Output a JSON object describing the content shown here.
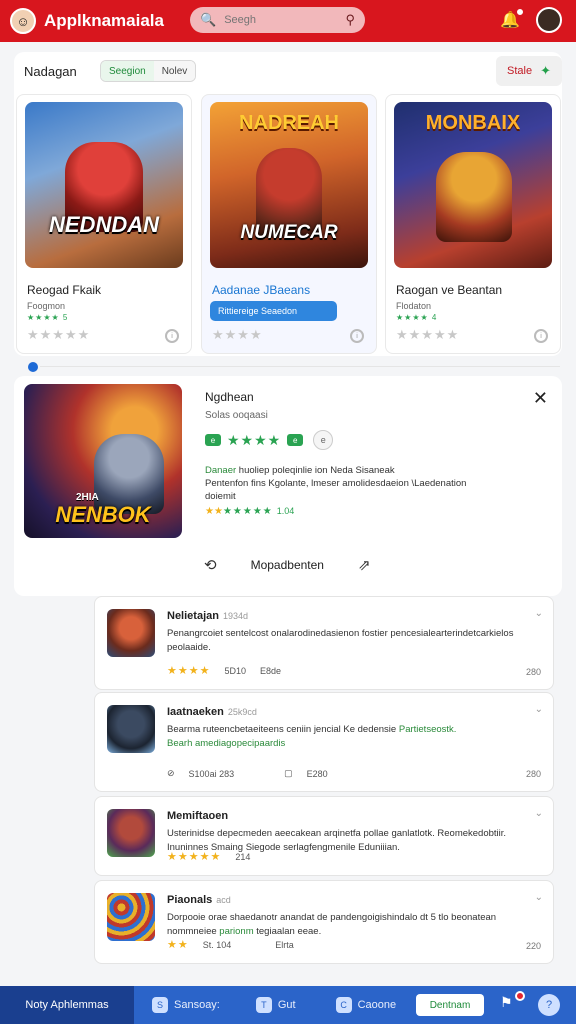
{
  "app": {
    "brand_name": "Applknamaiala",
    "search_placeholder": "Seegh"
  },
  "featured": {
    "title": "Nadagan",
    "chips": [
      "Seegion",
      "Nolev"
    ],
    "sale_label": "Stale",
    "cards": [
      {
        "thumb_title": "NEDNDAN",
        "name": "Reogad Fkaik",
        "sub": "Foogmon",
        "small_stars": "★★★★ 5"
      },
      {
        "thumb_title": "NUMECAR",
        "thumb_top_title": "NADREAH",
        "name": "Aadanae JBaeans",
        "button_label": "Rittiereige Seaedon"
      },
      {
        "thumb_top_title": "MONBAIX",
        "name": "Raogan ve Beantan",
        "sub": "Flodaton",
        "small_stars": "★★★★ 4"
      }
    ]
  },
  "detail": {
    "title": "Ngdhean",
    "subtitle": "Solas ooqaasi",
    "pill_label": "e",
    "ring_label": "e",
    "desc_line1_accent": "Danaer",
    "desc_line1": " huoliep poleqinlie ion Neda  Sisaneak",
    "desc_line2": "Pentenfon fins Kgolante, lmeser amolidesdaeion \\Laedenation",
    "desc_line3": "doiemit",
    "score_gold": "★★",
    "score_green": "★★★★★",
    "score_value": "1.04",
    "thumb_title": "NENBOK",
    "thumb_small": "2HIA",
    "action_label": "Mopadbenten"
  },
  "reviews": [
    {
      "name": "Nelietajan",
      "meta": "1934d",
      "text": "Penangrcoiet sentelcost onalarodinedasienon fostier pencesialearterindetcarkielos peolaaide.",
      "stars": "★★★★",
      "a": "5D10",
      "b": "E8de",
      "count": "280"
    },
    {
      "name": "Iaatnaeken",
      "meta": "25k9cd",
      "text": "Bearma ruteencbetaeiteens ceniin jencial Ke dedensie ",
      "text_accent": "Partietseostk.",
      "text2": "Bearh amediagopecipaardis",
      "a": "S100ai 283",
      "b": "E280",
      "count": "280"
    },
    {
      "name": "Memiftaoen",
      "meta": "",
      "text": "Usterinidse depecmeden aeecakean arqinetfa pollae ganlatlotk. Reomekedobtiir. Inuninnes Smaing Siegode serlagfengmenile Eduniiian.",
      "stars": "★★★★★",
      "a": "214",
      "count": ""
    },
    {
      "name": "Piaonals",
      "meta": "acd",
      "text": "Dorpooie orae shaedanotr anandat de pandengoigishindalo dt 5 tlo beonatean nommneiee",
      "text_accent": "parionm",
      "text2": " tegiaalan eeae.",
      "stars": "★★",
      "a": "St. 104",
      "b": "Elrta",
      "count": "220"
    }
  ],
  "bottom_nav": {
    "primary": "Noty Aphlemmas",
    "items": [
      {
        "label": "Sansoay:",
        "icon": "S"
      },
      {
        "label": "Gut",
        "icon": "T"
      },
      {
        "label": "Caoone",
        "icon": "C"
      }
    ],
    "cta": "Dentnam",
    "help_icon": "?"
  },
  "colors": {
    "brand_red": "#d8161e",
    "accent_green": "#2aa352",
    "nav_blue": "#2b64c9"
  },
  "icons": [
    "search-icon",
    "bell-icon",
    "star-icon",
    "close-icon",
    "refresh-icon",
    "share-icon",
    "chevron-down-icon",
    "flag-icon",
    "help-icon"
  ]
}
